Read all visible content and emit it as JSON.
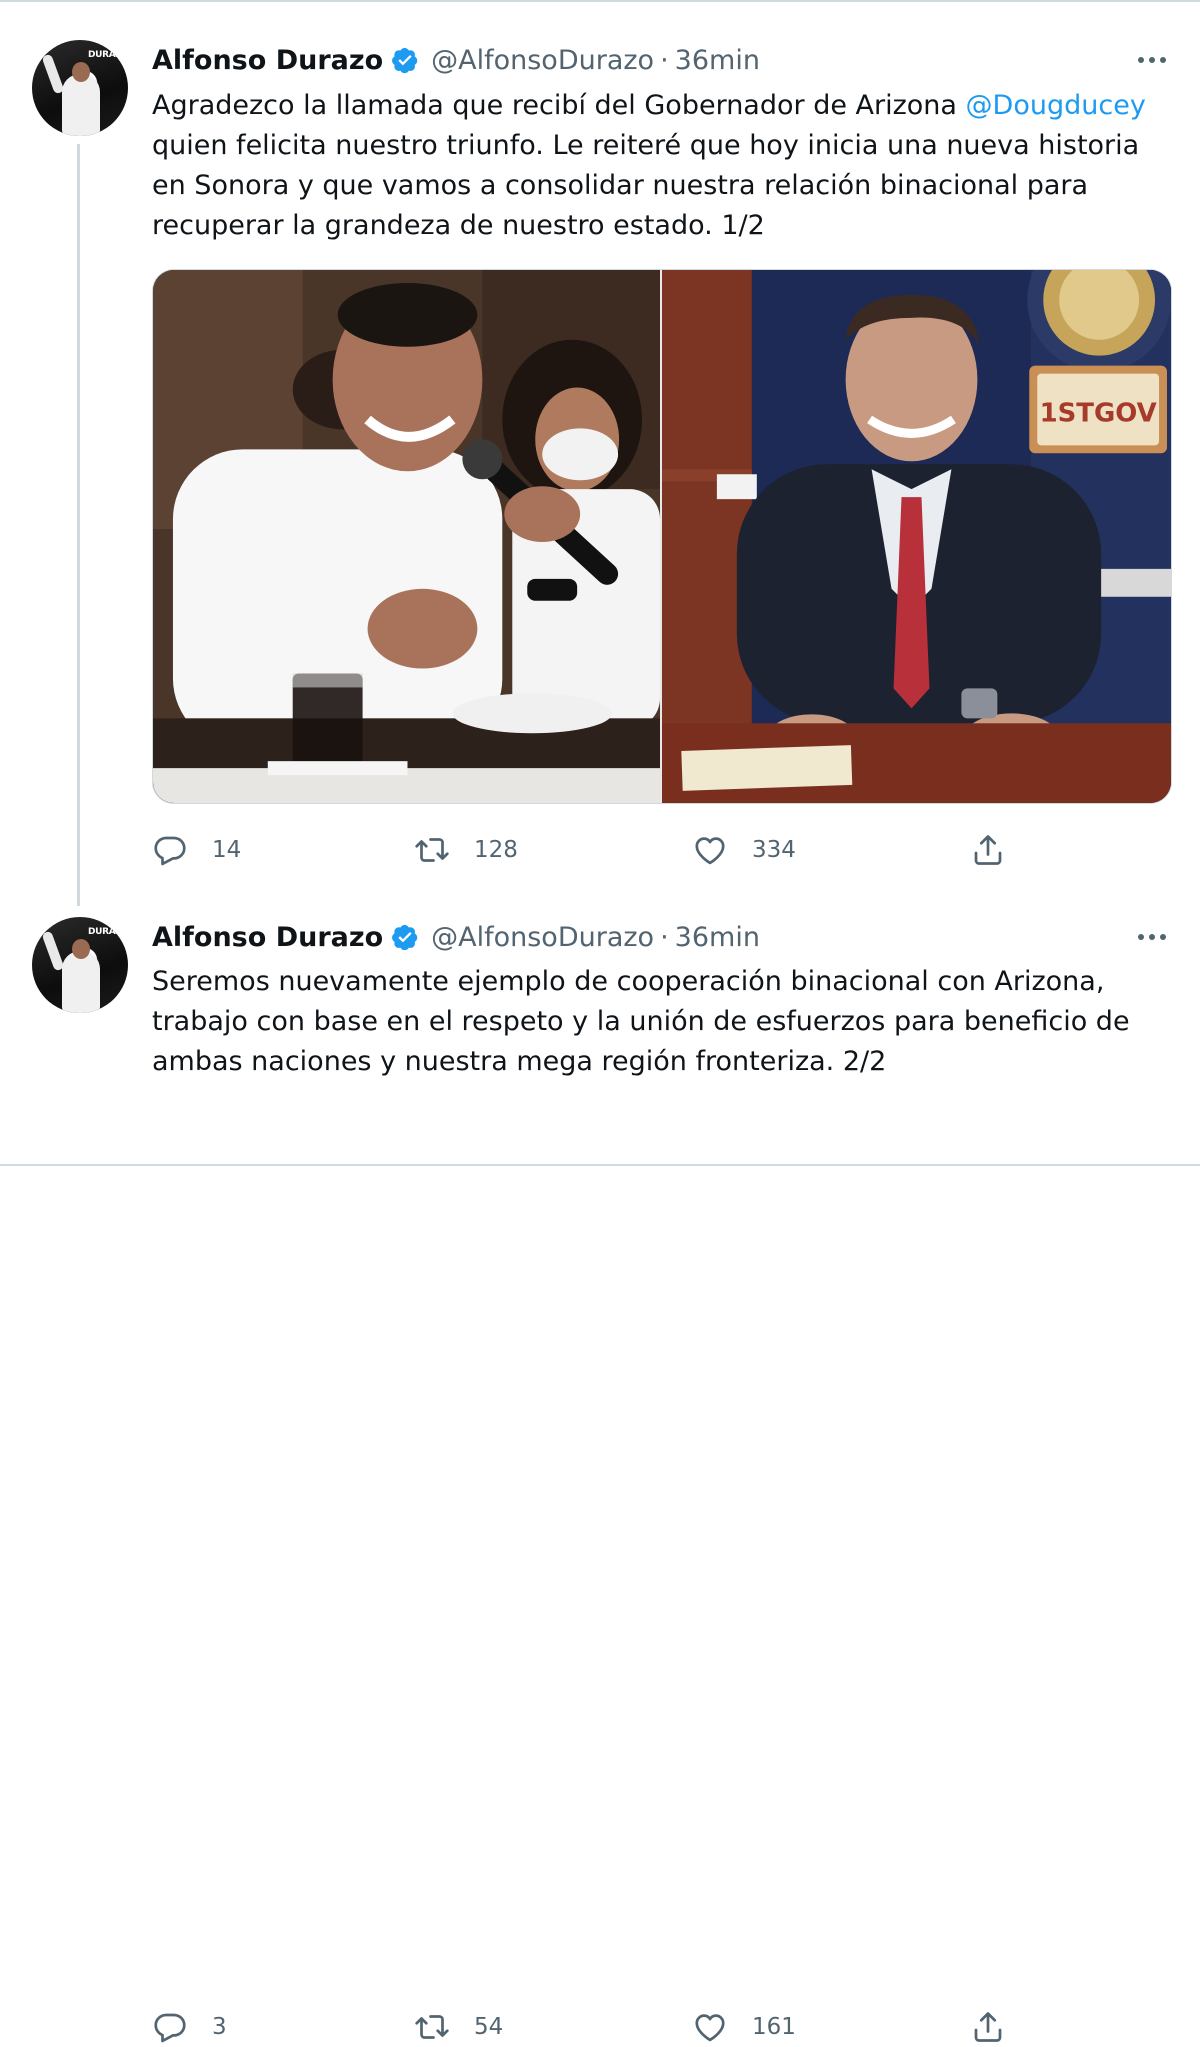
{
  "tweets": [
    {
      "author_name": "Alfonso Durazo",
      "handle": "@AlfonsoDurazo",
      "separator": "·",
      "time": "36min",
      "avatar_text": "DURAZO",
      "text_before_mention": "Agradezco la llamada que recibí del Gobernador de Arizona ",
      "mention": "@Dougducey",
      "text_after_mention": " quien felicita nuestro triunfo. Le reiteré que hoy inicia una nueva historia en Sonora y que vamos a consolidar nuestra relación binacional para recuperar la grandeza de nuestro estado. 1/2",
      "plate_text": "1STGOV",
      "reply_count": "14",
      "retweet_count": "128",
      "like_count": "334"
    },
    {
      "author_name": "Alfonso Durazo",
      "handle": "@AlfonsoDurazo",
      "separator": "·",
      "time": "36min",
      "avatar_text": "DURAZO",
      "text": "Seremos nuevamente ejemplo de cooperación binacional con Arizona, trabajo con base en el respeto y la unión de esfuerzos para beneficio de ambas naciones y nuestra mega región fronteriza. 2/2",
      "reply_count": "3",
      "retweet_count": "54",
      "like_count": "161"
    }
  ],
  "colors": {
    "link": "#1d9bf0",
    "secondary_text": "#536471",
    "primary_text": "#0f1419",
    "divider": "#cfd9de"
  },
  "icons": [
    "verified-badge-icon",
    "more-options-icon",
    "reply-icon",
    "retweet-icon",
    "like-icon",
    "share-icon"
  ]
}
